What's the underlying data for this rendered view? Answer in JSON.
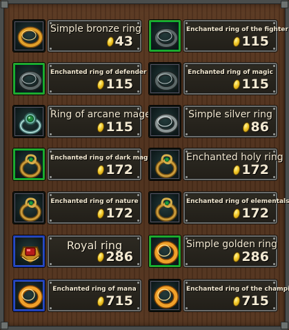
{
  "shop": {
    "items": [
      {
        "name": "Simple bronze ring",
        "price": "43",
        "icon": "bronze-ring-icon",
        "slot": "plain",
        "size": "big"
      },
      {
        "name": "Enchanted ring of the fighter",
        "price": "115",
        "icon": "dark-ring-icon",
        "slot": "green",
        "size": "small"
      },
      {
        "name": "Enchanted ring of defender",
        "price": "115",
        "icon": "dark-ring-icon",
        "slot": "green",
        "size": "small"
      },
      {
        "name": "Enchanted ring of magic",
        "price": "115",
        "icon": "dark-ring-icon",
        "slot": "plain",
        "size": "small"
      },
      {
        "name": "Ring of arcane mage",
        "price": "115",
        "icon": "emerald-ring-icon",
        "slot": "plain",
        "size": "big"
      },
      {
        "name": "Simple silver ring",
        "price": "86",
        "icon": "silver-ring-icon",
        "slot": "plain",
        "size": "big"
      },
      {
        "name": "Enchanted ring of dark magic",
        "price": "172",
        "icon": "spiral-ring-icon",
        "slot": "green",
        "size": "small"
      },
      {
        "name": "Enchanted holy ring",
        "price": "172",
        "icon": "spiral-ring-icon",
        "slot": "plain",
        "size": "big"
      },
      {
        "name": "Enchanted ring of nature",
        "price": "172",
        "icon": "spiral-ring-icon",
        "slot": "plain",
        "size": "small"
      },
      {
        "name": "Enchanted ring of elementals",
        "price": "172",
        "icon": "spiral-ring-icon",
        "slot": "plain",
        "size": "small"
      },
      {
        "name": "Royal ring",
        "price": "286",
        "icon": "ruby-ring-icon",
        "slot": "blue",
        "size": "xl"
      },
      {
        "name": "Simple golden ring",
        "price": "286",
        "icon": "gold-ring-icon",
        "slot": "green",
        "size": "big"
      },
      {
        "name": "Enchanted ring of mana",
        "price": "715",
        "icon": "gold-ring-icon",
        "slot": "blue",
        "size": "small"
      },
      {
        "name": "Enchanted ring of the champion",
        "price": "715",
        "icon": "gold-ring-icon",
        "slot": "plain",
        "size": "small"
      }
    ]
  },
  "colors": {
    "coin": "#f1c626",
    "text": "#f3e9d2",
    "green_frame": "#2aa42d",
    "blue_frame": "#1f3fb8"
  }
}
